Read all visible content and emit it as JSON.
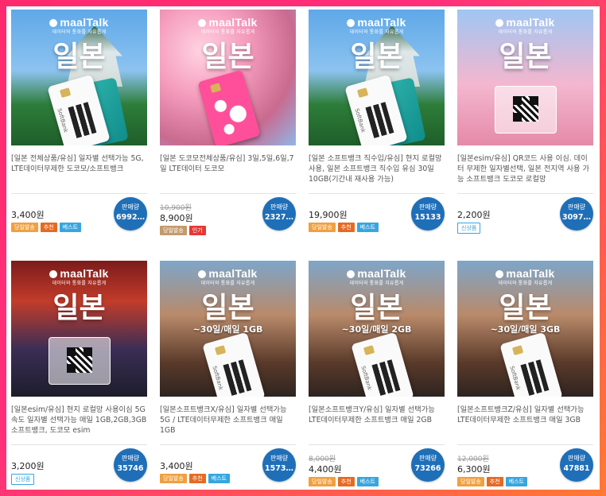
{
  "brand": {
    "name": "maalTalk",
    "tagline": "데이터와 통화를 자유롭게"
  },
  "products": [
    {
      "title_big": "일본",
      "plan": "",
      "image": "castle",
      "sim": "white",
      "description": "[일본 전체상품/유심] 일자별 선택가능 5G, LTE데이터무제한 도코모/소프트뱅크",
      "old_price": "",
      "price": "3,400원",
      "tags": [
        {
          "label": "당일발송",
          "style": "orange"
        },
        {
          "label": "추천",
          "style": "orange2"
        },
        {
          "label": "베스트",
          "style": "blue"
        }
      ],
      "sales_label": "판매량",
      "sales_count": "6992…"
    },
    {
      "title_big": "일본",
      "plan": "",
      "image": "blossom",
      "sim": "pink",
      "description": "[일본 도코모전체상품/유심] 3일,5일,6일,7일 LTE데이터 도코모",
      "old_price": "10,900원",
      "price": "8,900원",
      "tags": [
        {
          "label": "당일발송",
          "style": "brown"
        },
        {
          "label": "인기",
          "style": "red"
        }
      ],
      "sales_label": "판매량",
      "sales_count": "2327…"
    },
    {
      "title_big": "일본",
      "plan": "",
      "image": "castle",
      "sim": "white",
      "description": "[일본 소프트뱅크 직수입/유심] 현지 로컬망 사용, 일본 소프트뱅크 직수입 유심 30일 10GB(기간내 재사용 가능)",
      "old_price": "",
      "price": "19,900원",
      "tags": [
        {
          "label": "당일발송",
          "style": "orange"
        },
        {
          "label": "추천",
          "style": "orange2"
        },
        {
          "label": "베스트",
          "style": "blue"
        }
      ],
      "sales_label": "판매량",
      "sales_count": "15133"
    },
    {
      "title_big": "일본",
      "plan": "",
      "image": "tower",
      "sim": "qr",
      "description": "[일본esim/유심] QR코드 사용 이심. 데이터 무제한 일자별선택, 일본 전지역 사용 가능 소프트뱅크 도코모 로컬망",
      "old_price": "",
      "price": "2,200원",
      "tags": [
        {
          "label": "신상품",
          "style": "outline"
        }
      ],
      "sales_label": "판매량",
      "sales_count": "3097…"
    },
    {
      "title_big": "일본",
      "plan": "",
      "image": "street",
      "sim": "qr",
      "description": "[일본esim/유심] 현지 로컬망 사용이심 5G 속도 일자별 선택가능 매일 1GB,2GB,3GB 소프트뱅크, 도코모 esim",
      "old_price": "",
      "price": "3,200원",
      "tags": [
        {
          "label": "신상품",
          "style": "outline"
        }
      ],
      "sales_label": "판매량",
      "sales_count": "35746"
    },
    {
      "title_big": "일본",
      "plan": "~30일/매일 1GB",
      "image": "kyoto",
      "sim": "white",
      "description": "[일본소프트뱅크X/유심] 일자별 선택가능 5G / LTE데이터무제한 소프트뱅크 매일 1GB",
      "old_price": "",
      "price": "3,400원",
      "tags": [
        {
          "label": "당일발송",
          "style": "orange"
        },
        {
          "label": "추천",
          "style": "orange2"
        },
        {
          "label": "베스트",
          "style": "blue"
        }
      ],
      "sales_label": "판매량",
      "sales_count": "1573…"
    },
    {
      "title_big": "일본",
      "plan": "~30일/매일 2GB",
      "image": "kyoto",
      "sim": "white",
      "description": "[일본소프트뱅크Y/유심] 일자별 선택가능 LTE데이터무제한 소프트뱅크 매일 2GB",
      "old_price": "8,000원",
      "price": "4,400원",
      "tags": [
        {
          "label": "당일발송",
          "style": "orange"
        },
        {
          "label": "추천",
          "style": "orange2"
        },
        {
          "label": "베스트",
          "style": "blue"
        }
      ],
      "sales_label": "판매량",
      "sales_count": "73266"
    },
    {
      "title_big": "일본",
      "plan": "~30일/매일 3GB",
      "image": "kyoto",
      "sim": "white",
      "description": "[일본소프트뱅크Z/유심] 일자별 선택가능 LTE데이터무제한 소프트뱅크 매일 3GB",
      "old_price": "12,000원",
      "price": "6,300원",
      "tags": [
        {
          "label": "당일발송",
          "style": "orange"
        },
        {
          "label": "추천",
          "style": "orange2"
        },
        {
          "label": "베스트",
          "style": "blue"
        }
      ],
      "sales_label": "판매량",
      "sales_count": "47881"
    }
  ]
}
